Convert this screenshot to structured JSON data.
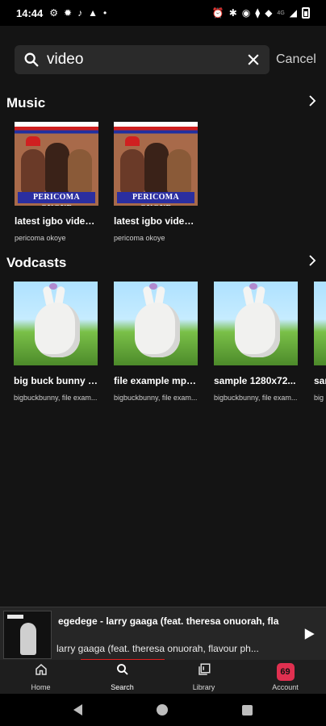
{
  "status_bar": {
    "time": "14:44",
    "network_label": "4G"
  },
  "search": {
    "query": "video",
    "cancel_label": "Cancel"
  },
  "sections": {
    "music": {
      "title": "Music",
      "items": [
        {
          "title": "latest igbo video...",
          "subtitle": "pericoma okoye",
          "thumb_text": "PERICOMA OKOYE"
        },
        {
          "title": "latest igbo video...",
          "subtitle": "pericoma okoye",
          "thumb_text": "PERICOMA OKOYE"
        }
      ]
    },
    "vodcasts": {
      "title": "Vodcasts",
      "items": [
        {
          "title": "big buck bunny a...",
          "subtitle": "bigbuckbunny, file exam..."
        },
        {
          "title": "file example mp4...",
          "subtitle": "bigbuckbunny, file exam..."
        },
        {
          "title": "sample 1280x72...",
          "subtitle": "bigbuckbunny, file exam..."
        },
        {
          "title": "sam",
          "subtitle": "big"
        }
      ]
    }
  },
  "player": {
    "title": "egedege - larry gaaga (feat. theresa onuorah, fla",
    "artist": "larry gaaga (feat. theresa onuorah, flavour  ph...",
    "progress_color": "#e02020"
  },
  "nav": {
    "tabs": [
      {
        "label": "Home",
        "icon": "home-icon"
      },
      {
        "label": "Search",
        "icon": "search-icon"
      },
      {
        "label": "Library",
        "icon": "library-icon"
      },
      {
        "label": "Account",
        "icon": "account-icon"
      }
    ],
    "account_icon_color": "#e03050"
  }
}
